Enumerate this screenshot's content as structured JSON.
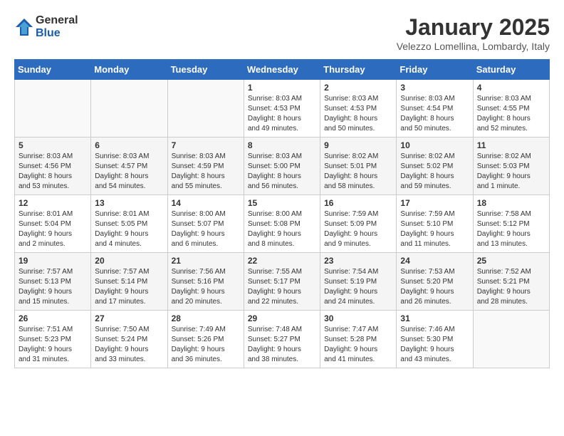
{
  "header": {
    "logo": {
      "general": "General",
      "blue": "Blue"
    },
    "month_year": "January 2025",
    "location": "Velezzo Lomellina, Lombardy, Italy"
  },
  "weekdays": [
    "Sunday",
    "Monday",
    "Tuesday",
    "Wednesday",
    "Thursday",
    "Friday",
    "Saturday"
  ],
  "weeks": [
    [
      {
        "day": "",
        "info": ""
      },
      {
        "day": "",
        "info": ""
      },
      {
        "day": "",
        "info": ""
      },
      {
        "day": "1",
        "info": "Sunrise: 8:03 AM\nSunset: 4:53 PM\nDaylight: 8 hours\nand 49 minutes."
      },
      {
        "day": "2",
        "info": "Sunrise: 8:03 AM\nSunset: 4:53 PM\nDaylight: 8 hours\nand 50 minutes."
      },
      {
        "day": "3",
        "info": "Sunrise: 8:03 AM\nSunset: 4:54 PM\nDaylight: 8 hours\nand 50 minutes."
      },
      {
        "day": "4",
        "info": "Sunrise: 8:03 AM\nSunset: 4:55 PM\nDaylight: 8 hours\nand 52 minutes."
      }
    ],
    [
      {
        "day": "5",
        "info": "Sunrise: 8:03 AM\nSunset: 4:56 PM\nDaylight: 8 hours\nand 53 minutes."
      },
      {
        "day": "6",
        "info": "Sunrise: 8:03 AM\nSunset: 4:57 PM\nDaylight: 8 hours\nand 54 minutes."
      },
      {
        "day": "7",
        "info": "Sunrise: 8:03 AM\nSunset: 4:59 PM\nDaylight: 8 hours\nand 55 minutes."
      },
      {
        "day": "8",
        "info": "Sunrise: 8:03 AM\nSunset: 5:00 PM\nDaylight: 8 hours\nand 56 minutes."
      },
      {
        "day": "9",
        "info": "Sunrise: 8:02 AM\nSunset: 5:01 PM\nDaylight: 8 hours\nand 58 minutes."
      },
      {
        "day": "10",
        "info": "Sunrise: 8:02 AM\nSunset: 5:02 PM\nDaylight: 8 hours\nand 59 minutes."
      },
      {
        "day": "11",
        "info": "Sunrise: 8:02 AM\nSunset: 5:03 PM\nDaylight: 9 hours\nand 1 minute."
      }
    ],
    [
      {
        "day": "12",
        "info": "Sunrise: 8:01 AM\nSunset: 5:04 PM\nDaylight: 9 hours\nand 2 minutes."
      },
      {
        "day": "13",
        "info": "Sunrise: 8:01 AM\nSunset: 5:05 PM\nDaylight: 9 hours\nand 4 minutes."
      },
      {
        "day": "14",
        "info": "Sunrise: 8:00 AM\nSunset: 5:07 PM\nDaylight: 9 hours\nand 6 minutes."
      },
      {
        "day": "15",
        "info": "Sunrise: 8:00 AM\nSunset: 5:08 PM\nDaylight: 9 hours\nand 8 minutes."
      },
      {
        "day": "16",
        "info": "Sunrise: 7:59 AM\nSunset: 5:09 PM\nDaylight: 9 hours\nand 9 minutes."
      },
      {
        "day": "17",
        "info": "Sunrise: 7:59 AM\nSunset: 5:10 PM\nDaylight: 9 hours\nand 11 minutes."
      },
      {
        "day": "18",
        "info": "Sunrise: 7:58 AM\nSunset: 5:12 PM\nDaylight: 9 hours\nand 13 minutes."
      }
    ],
    [
      {
        "day": "19",
        "info": "Sunrise: 7:57 AM\nSunset: 5:13 PM\nDaylight: 9 hours\nand 15 minutes."
      },
      {
        "day": "20",
        "info": "Sunrise: 7:57 AM\nSunset: 5:14 PM\nDaylight: 9 hours\nand 17 minutes."
      },
      {
        "day": "21",
        "info": "Sunrise: 7:56 AM\nSunset: 5:16 PM\nDaylight: 9 hours\nand 20 minutes."
      },
      {
        "day": "22",
        "info": "Sunrise: 7:55 AM\nSunset: 5:17 PM\nDaylight: 9 hours\nand 22 minutes."
      },
      {
        "day": "23",
        "info": "Sunrise: 7:54 AM\nSunset: 5:19 PM\nDaylight: 9 hours\nand 24 minutes."
      },
      {
        "day": "24",
        "info": "Sunrise: 7:53 AM\nSunset: 5:20 PM\nDaylight: 9 hours\nand 26 minutes."
      },
      {
        "day": "25",
        "info": "Sunrise: 7:52 AM\nSunset: 5:21 PM\nDaylight: 9 hours\nand 28 minutes."
      }
    ],
    [
      {
        "day": "26",
        "info": "Sunrise: 7:51 AM\nSunset: 5:23 PM\nDaylight: 9 hours\nand 31 minutes."
      },
      {
        "day": "27",
        "info": "Sunrise: 7:50 AM\nSunset: 5:24 PM\nDaylight: 9 hours\nand 33 minutes."
      },
      {
        "day": "28",
        "info": "Sunrise: 7:49 AM\nSunset: 5:26 PM\nDaylight: 9 hours\nand 36 minutes."
      },
      {
        "day": "29",
        "info": "Sunrise: 7:48 AM\nSunset: 5:27 PM\nDaylight: 9 hours\nand 38 minutes."
      },
      {
        "day": "30",
        "info": "Sunrise: 7:47 AM\nSunset: 5:28 PM\nDaylight: 9 hours\nand 41 minutes."
      },
      {
        "day": "31",
        "info": "Sunrise: 7:46 AM\nSunset: 5:30 PM\nDaylight: 9 hours\nand 43 minutes."
      },
      {
        "day": "",
        "info": ""
      }
    ]
  ]
}
